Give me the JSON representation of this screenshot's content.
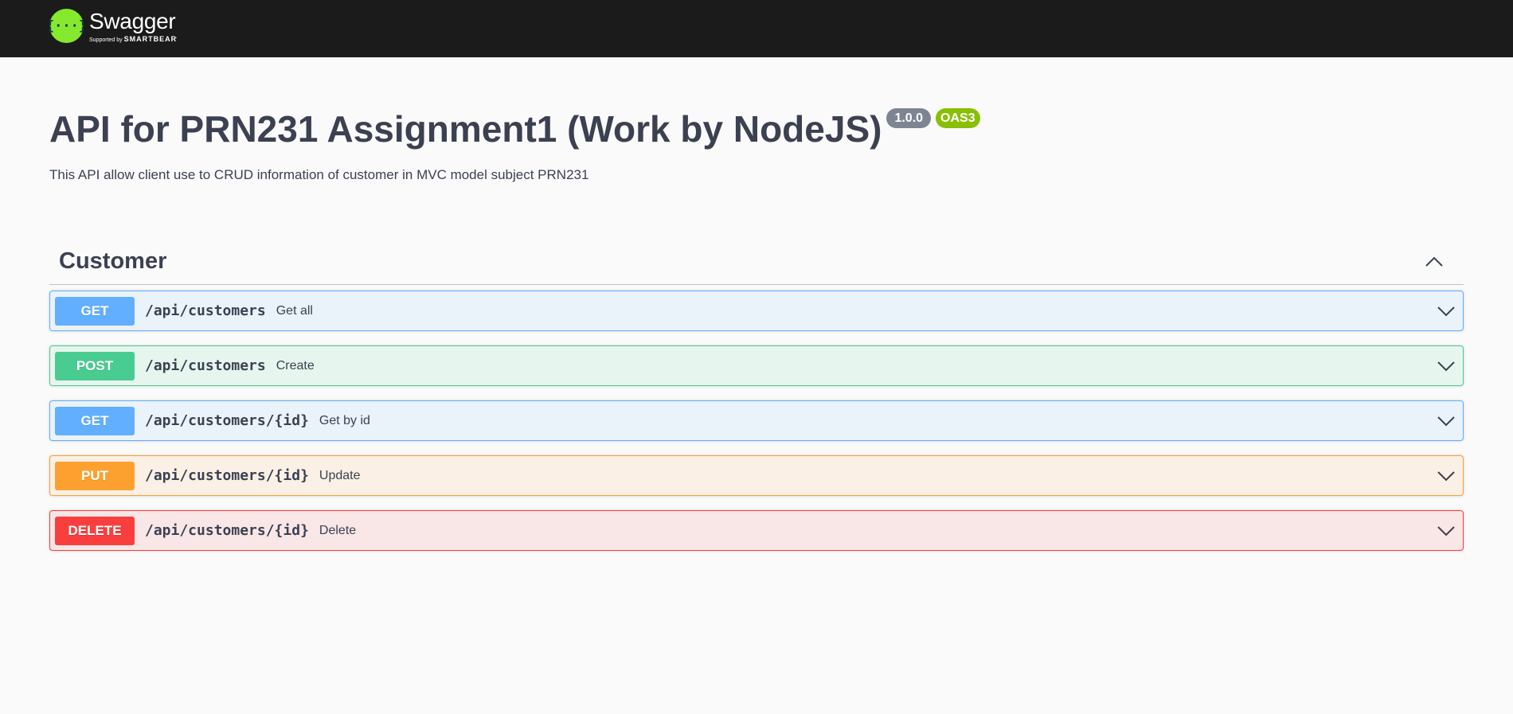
{
  "topbar": {
    "brand_name": "Swagger",
    "brand_mark": ".",
    "brand_supported_by": "Supported by",
    "brand_company": "SMARTBEAR",
    "logo_icon": "swagger-braces-icon",
    "logo_color": "#85ea2d",
    "background": "#1b1b1b"
  },
  "info": {
    "title": "API for PRN231 Assignment1 (Work by NodeJS)",
    "version_badge": "1.0.0",
    "spec_badge": "OAS3",
    "description": "This API allow client use to CRUD information of customer in MVC model subject PRN231"
  },
  "tag": {
    "name": "Customer",
    "toggle_icon": "chevron-up-icon",
    "expanded": true
  },
  "operations": [
    {
      "method": "GET",
      "path": "/api/customers",
      "summary": "Get all",
      "color": "#61affe"
    },
    {
      "method": "POST",
      "path": "/api/customers",
      "summary": "Create",
      "color": "#49cc90"
    },
    {
      "method": "GET",
      "path": "/api/customers/{id}",
      "summary": "Get by id",
      "color": "#61affe"
    },
    {
      "method": "PUT",
      "path": "/api/customers/{id}",
      "summary": "Update",
      "color": "#fca130"
    },
    {
      "method": "DELETE",
      "path": "/api/customers/{id}",
      "summary": "Delete",
      "color": "#f93e3e"
    }
  ]
}
